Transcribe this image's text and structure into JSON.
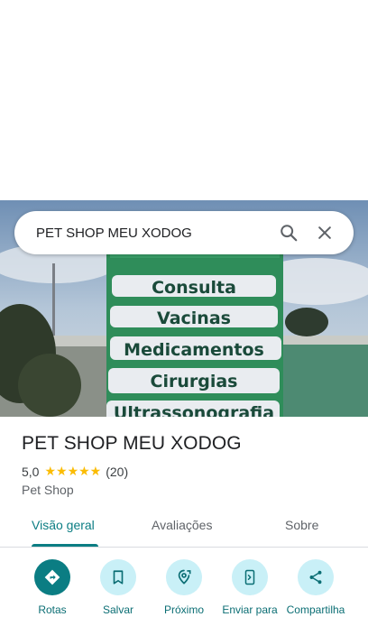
{
  "search": {
    "query": "PET SHOP MEU XODOG"
  },
  "hero": {
    "sign_lines": [
      "Consulta",
      "Vacinas",
      "Medicamentos",
      "Cirurgias",
      "Ultrassonografia"
    ]
  },
  "place": {
    "name": "PET SHOP MEU XODOG",
    "rating": "5,0",
    "stars": "★★★★★",
    "reviews": "(20)",
    "category": "Pet Shop"
  },
  "tabs": [
    {
      "label": "Visão geral",
      "active": true
    },
    {
      "label": "Avaliações"
    },
    {
      "label": "Sobre"
    }
  ],
  "actions": [
    {
      "label": "Rotas",
      "icon": "directions-icon"
    },
    {
      "label": "Salvar",
      "icon": "bookmark-icon"
    },
    {
      "label": "Próximo",
      "icon": "nearby-icon"
    },
    {
      "label": "Enviar para",
      "icon": "send-to-phone-icon"
    },
    {
      "label": "Compartilha",
      "icon": "share-icon"
    }
  ],
  "colors": {
    "accent": "#0b7d83",
    "action_bg": "#c9f0f7",
    "star": "#fbbc04"
  }
}
